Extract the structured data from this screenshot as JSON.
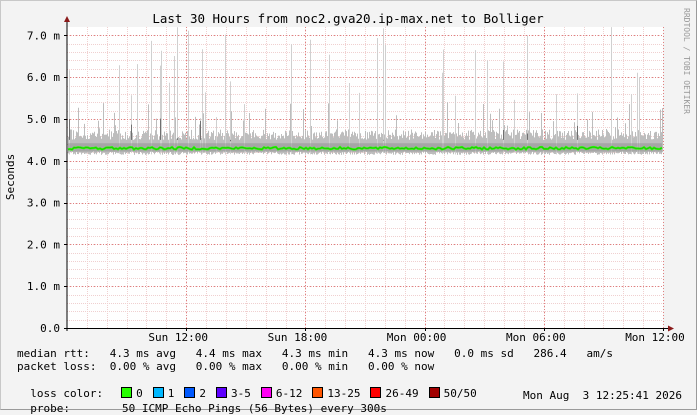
{
  "chart_data": {
    "type": "line",
    "title": "Last 30 Hours from noc2.gva20.ip-max.net to Bolliger",
    "ylabel": "Seconds",
    "xlabel": "",
    "ylim": [
      0,
      7.2
    ],
    "y_unit": "ms",
    "yticks": [
      {
        "value": 0.0,
        "label": "0.0"
      },
      {
        "value": 1.0,
        "label": "1.0 m"
      },
      {
        "value": 2.0,
        "label": "2.0 m"
      },
      {
        "value": 3.0,
        "label": "3.0 m"
      },
      {
        "value": 4.0,
        "label": "4.0 m"
      },
      {
        "value": 5.0,
        "label": "5.0 m"
      },
      {
        "value": 6.0,
        "label": "6.0 m"
      },
      {
        "value": 7.0,
        "label": "7.0 m"
      }
    ],
    "xlim_hours": [
      0,
      30
    ],
    "xticks": [
      {
        "hour": 6,
        "label": "Sun 12:00"
      },
      {
        "hour": 12,
        "label": "Sun 18:00"
      },
      {
        "hour": 18,
        "label": "Mon 00:00"
      },
      {
        "hour": 24,
        "label": "Mon 06:00"
      },
      {
        "hour": 30,
        "label": "Mon 12:00"
      }
    ],
    "grid": true,
    "median_rtt_ms": 4.3,
    "smoke_band_ms": [
      4.22,
      4.5
    ],
    "watermark": "RRDTOOL / TOBI OETIKER"
  },
  "legend": {
    "median_rtt": "median rtt:   4.3 ms avg   4.4 ms max   4.3 ms min   4.3 ms now   0.0 ms sd   286.4   am/s",
    "packet_loss": "packet loss:  0.00 % avg   0.00 % max   0.00 % min   0.00 % now",
    "loss_color_label": "loss color:",
    "loss_colors": [
      {
        "label": "0",
        "color": "#26ff00"
      },
      {
        "label": "1",
        "color": "#00b8ff"
      },
      {
        "label": "2",
        "color": "#0059ff"
      },
      {
        "label": "3-5",
        "color": "#5e00ff"
      },
      {
        "label": "6-12",
        "color": "#ff00f4"
      },
      {
        "label": "13-25",
        "color": "#ff5500"
      },
      {
        "label": "26-49",
        "color": "#ff0000"
      },
      {
        "label": "50/50",
        "color": "#a10000"
      }
    ],
    "probe_label": "probe:",
    "probe_text": "50 ICMP Echo Pings (56 Bytes) every 300s",
    "timestamp": "Mon Aug  3 12:25:41 2026"
  }
}
